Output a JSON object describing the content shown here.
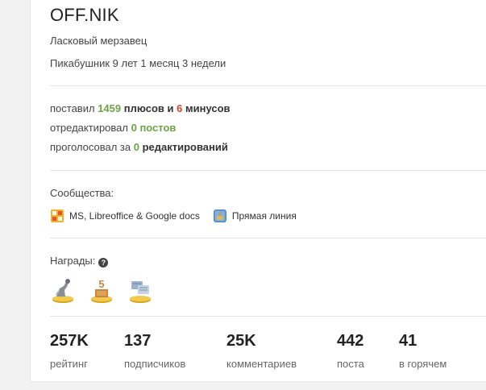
{
  "profile": {
    "username": "OFF.NIK",
    "subtitle": "Ласковый мерзавец",
    "since": "Пикабушник 9 лет 1 месяц 3 недели"
  },
  "activity": {
    "votes_prefix": "поставил ",
    "pluses": "1459",
    "pluses_word": " плюсов",
    "and": " и ",
    "minuses": "6",
    "minuses_word": " минусов",
    "edited_prefix": "отредактировал ",
    "edited_count": "0",
    "edited_word": " постов",
    "voted_prefix": "проголосовал за ",
    "voted_count": "0",
    "voted_word": " редактирований"
  },
  "communities": {
    "title": "Сообщества:",
    "items": [
      {
        "name": "MS, Libreoffice & Google docs",
        "icon": "office-icon"
      },
      {
        "name": "Прямая линия",
        "icon": "kremlin-icon"
      }
    ]
  },
  "awards": {
    "title": "Награды:",
    "items": [
      {
        "icon": "statue-award-icon"
      },
      {
        "icon": "five-years-award-icon"
      },
      {
        "icon": "comments-award-icon"
      }
    ]
  },
  "counters": [
    {
      "value": "257K",
      "label": "рейтинг"
    },
    {
      "value": "137",
      "label": "подписчиков"
    },
    {
      "value": "25K",
      "label": "комментариев"
    },
    {
      "value": "442",
      "label": "поста"
    },
    {
      "value": "41",
      "label": "в горячем"
    }
  ],
  "colors": {
    "positive": "#6ea345",
    "negative": "#d4452f"
  }
}
